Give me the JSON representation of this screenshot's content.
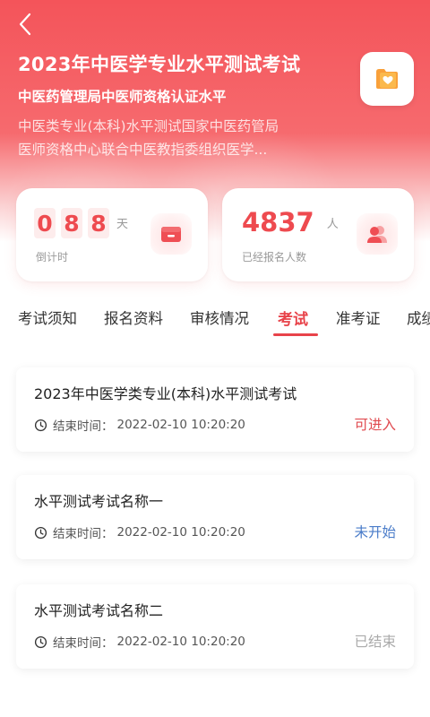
{
  "header": {
    "title": "2023年中医学专业水平测试考试",
    "subtitle": "中医药管理局中医师资格认证水平",
    "description_lines": [
      "中医类专业(本科)水平测试国家中医药管局",
      "医师资格中心联合中医教指委组织医学..."
    ]
  },
  "stats": {
    "countdown": {
      "digits": [
        "0",
        "8",
        "8"
      ],
      "unit": "天",
      "label": "倒计时"
    },
    "registered": {
      "value": "4837",
      "unit": "人",
      "label": "已经报名人数"
    }
  },
  "tabs": [
    {
      "label": "考试须知",
      "active": false
    },
    {
      "label": "报名资料",
      "active": false
    },
    {
      "label": "审核情况",
      "active": false
    },
    {
      "label": "考试",
      "active": true
    },
    {
      "label": "准考证",
      "active": false
    },
    {
      "label": "成绩",
      "active": false
    }
  ],
  "exams": [
    {
      "title": "2023年中医学类专业(本科)水平测试考试",
      "end_label": "结束时间：",
      "end_time": "2022-02-10 10:20:20",
      "status": "可进入",
      "status_color": "#e04a4f"
    },
    {
      "title": "水平测试考试名称一",
      "end_label": "结束时间：",
      "end_time": "2022-02-10 10:20:20",
      "status": "未开始",
      "status_color": "#4a7cc9"
    },
    {
      "title": "水平测试考试名称二",
      "end_label": "结束时间：",
      "end_time": "2022-02-10 10:20:20",
      "status": "已结束",
      "status_color": "#aaaaaa"
    }
  ],
  "colors": {
    "accent": "#e8434a",
    "hero_top": "#f4545a"
  },
  "icons": {
    "back": "chevron-left-icon",
    "app": "heart-folder-icon",
    "countdown": "box-icon",
    "registered": "users-icon",
    "clock": "clock-icon"
  }
}
